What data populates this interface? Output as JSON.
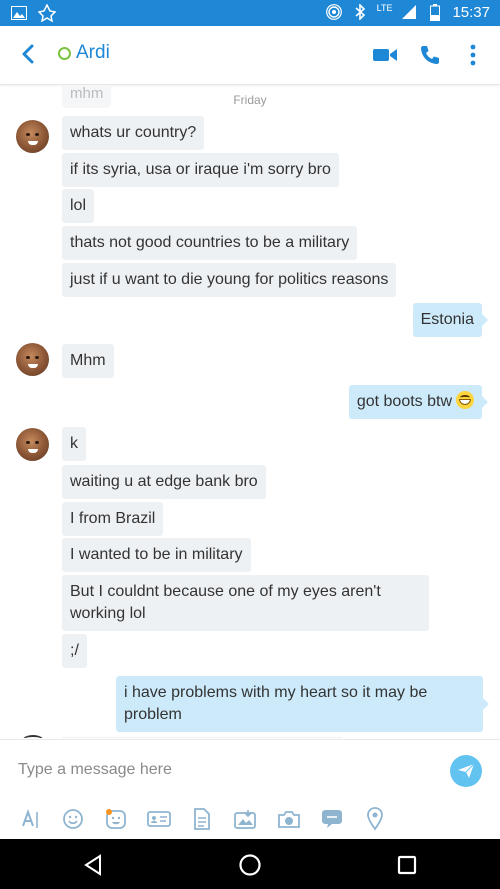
{
  "status_bar": {
    "time": "15:37",
    "network": "LTE",
    "accent": "#1e87d6"
  },
  "header": {
    "contact_name": "Ardi",
    "presence_color": "#7cc242"
  },
  "chat": {
    "previous_message": "mhm",
    "date_divider": "Friday",
    "messages": [
      {
        "dir": "in",
        "text": "whats ur country?"
      },
      {
        "dir": "in",
        "text": "if its syria, usa or iraque i'm sorry bro"
      },
      {
        "dir": "in",
        "text": "lol"
      },
      {
        "dir": "in",
        "text": "thats not good countries to be a military"
      },
      {
        "dir": "in",
        "text": "just if u want to die young for politics reasons"
      },
      {
        "dir": "out",
        "text": "Estonia"
      },
      {
        "dir": "in",
        "text": "Mhm"
      },
      {
        "dir": "out",
        "text": "got boots btw",
        "emoji": "grinning-face-emoji"
      },
      {
        "dir": "in",
        "text": "k"
      },
      {
        "dir": "in",
        "text": "waiting u at edge bank bro"
      },
      {
        "dir": "in",
        "text": "I from Brazil"
      },
      {
        "dir": "in",
        "text": "I wanted to be in military"
      },
      {
        "dir": "in",
        "text": "But I couldnt because one of my eyes aren't working lol"
      },
      {
        "dir": "in",
        "text": ";/"
      },
      {
        "dir": "out",
        "text": "i have problems with my heart so it may be problem"
      }
    ]
  },
  "composer": {
    "placeholder": "Type a message here",
    "tools": [
      "text-format-icon",
      "emoji-icon",
      "moji-icon",
      "contact-card-icon",
      "file-icon",
      "media-icon",
      "camera-icon",
      "chat-bubble-icon",
      "location-icon"
    ]
  },
  "colors": {
    "incoming_bubble": "#eef1f4",
    "outgoing_bubble": "#cdeafb",
    "send_button": "#63c3f0"
  }
}
